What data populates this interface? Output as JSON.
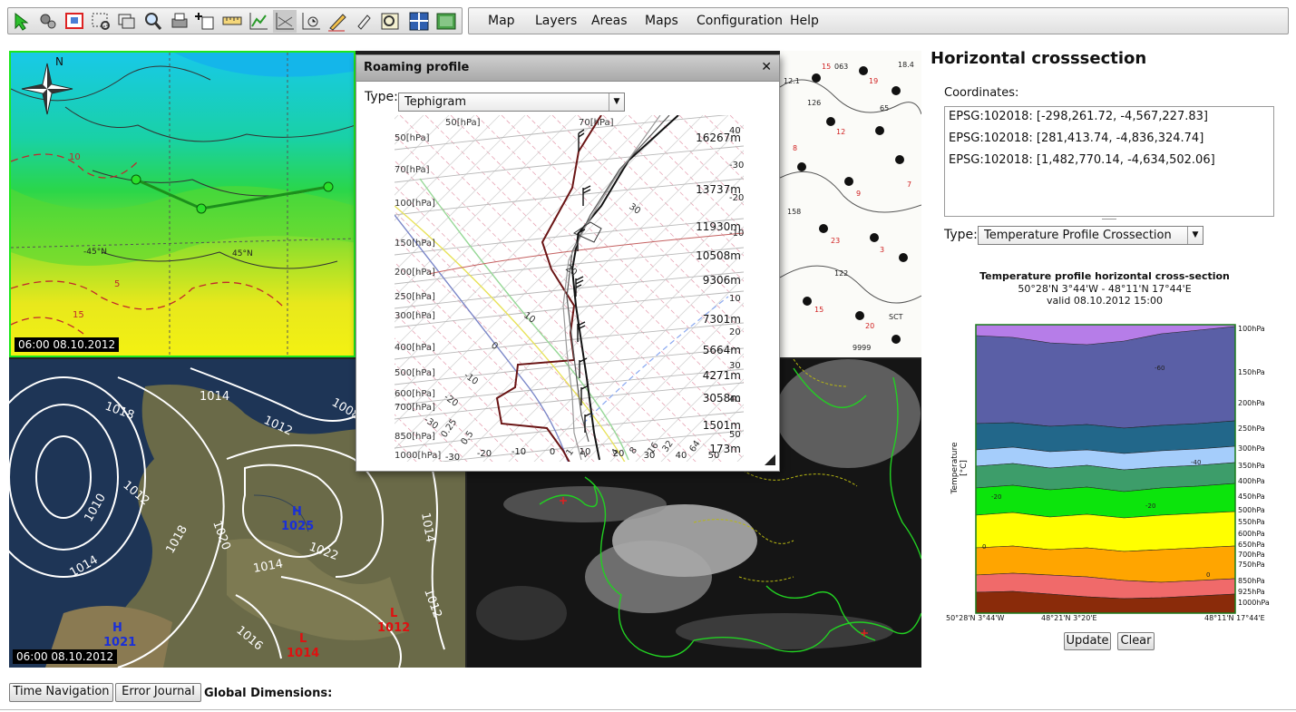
{
  "toolbar": {
    "icons": [
      "select-arrow-icon",
      "settings-icon",
      "zoom-extent-icon",
      "zoom-rect-icon",
      "layers-icon",
      "zoom-1-1-icon",
      "print-icon",
      "add-point-icon",
      "ruler-icon",
      "chart-icon",
      "crosssection-icon",
      "time-chart-icon",
      "draw-icon",
      "edit-icon",
      "preview-icon",
      "layout-icon",
      "fullscreen-icon"
    ]
  },
  "menu": [
    "Map",
    "Layers",
    "Areas",
    "Maps",
    "Configuration",
    "Help"
  ],
  "maps": {
    "top_left_time": "06:00 08.10.2012",
    "bottom_left_time": "06:00 08.10.2012",
    "compass_n": "N",
    "isobars": [
      "1018",
      "1014",
      "1012",
      "1010",
      "1012",
      "1014",
      "1018",
      "1020",
      "1022",
      "1014",
      "1016",
      "1012",
      "1014",
      "1008"
    ],
    "pressure_centers": [
      {
        "label": "H",
        "value": "1025",
        "color": "#1a2fd8"
      },
      {
        "label": "H",
        "value": "1021",
        "color": "#1a2fd8"
      },
      {
        "label": "L",
        "value": "1014",
        "color": "#e01010"
      },
      {
        "label": "L",
        "value": "1012",
        "color": "#e01010"
      }
    ],
    "temp_labels": [
      "10",
      "-45°N",
      "45°N",
      "15",
      "5"
    ]
  },
  "roaming": {
    "title": "Roaming profile",
    "type_label": "Type:",
    "type_value": "Tephigram",
    "pressure_labels": [
      "50[hPa]",
      "70[hPa]",
      "100[hPa]",
      "150[hPa]",
      "200[hPa]",
      "250[hPa]",
      "300[hPa]",
      "400[hPa]",
      "500[hPa]",
      "600[hPa]",
      "700[hPa]",
      "850[hPa]",
      "1000[hPa]"
    ],
    "top_labels": [
      "50[hPa]",
      "70[hPa]"
    ],
    "height_labels": [
      "16267m",
      "13737m",
      "11930m",
      "10508m",
      "9306m",
      "7301m",
      "5664m",
      "4271m",
      "3058m",
      "1501m",
      "173m"
    ],
    "temp_axis": [
      "-30",
      "-20",
      "-10",
      "0",
      "10",
      "20",
      "30",
      "40",
      "50"
    ],
    "right_axis": [
      "40",
      "-30",
      "-20",
      "-10",
      "10",
      "20",
      "30",
      "40",
      "50"
    ],
    "iso_labels": [
      "30",
      "20",
      "10",
      "0",
      "-10",
      "-20",
      "-30",
      "0.25",
      "0.5",
      "1",
      "2",
      "4",
      "8",
      "16",
      "32",
      "64"
    ]
  },
  "right_panel": {
    "title": "Horizontal crosssection",
    "coord_label": "Coordinates:",
    "coords": [
      "EPSG:102018: [-298,261.72, -4,567,227.83]",
      "EPSG:102018: [281,413.74, -4,836,324.74]",
      "EPSG:102018: [1,482,770.14, -4,634,502.06]"
    ],
    "type_label": "Type:",
    "type_value": "Temperature Profile Crossection",
    "chart_title": "Temperature profile horizontal cross-section",
    "chart_range": "50°28'N 3°44'W - 48°11'N 17°44'E",
    "chart_valid": "valid 08.10.2012 15:00",
    "update_button": "Update",
    "clear_button": "Clear"
  },
  "chart_data": {
    "type": "area",
    "title": "Temperature profile horizontal cross-section",
    "subtitle": "50°28'N 3°44'W - 48°11'N 17°44'E",
    "valid": "valid 08.10.2012 15:00",
    "ylabel": "Temperature\n[°C]",
    "y_ticks": [
      "100hPa",
      "150hPa",
      "200hPa",
      "250hPa",
      "300hPa",
      "350hPa",
      "400hPa",
      "450hPa",
      "500hPa",
      "550hPa",
      "600hPa",
      "650hPa",
      "700hPa",
      "750hPa",
      "850hPa",
      "925hPa",
      "1000hPa"
    ],
    "x_ticks": [
      "50°28'N 3°44'W",
      "48°21'N 3°20'E",
      "48°11'N 17°44'E"
    ],
    "contour_labels": [
      "-60",
      "-40",
      "-20",
      "-20",
      "0",
      "0"
    ],
    "bands_colors": [
      "#b67de8",
      "#5a5fa6",
      "#22678a",
      "#a5cdfb",
      "#3d9d6a",
      "#0ce40c",
      "#ffff00",
      "#ffa500",
      "#f06a6a",
      "#8a2b0a"
    ]
  },
  "bottom": {
    "time_nav": "Time Navigation",
    "error_journal": "Error Journal",
    "global_dims": "Global Dimensions:"
  }
}
